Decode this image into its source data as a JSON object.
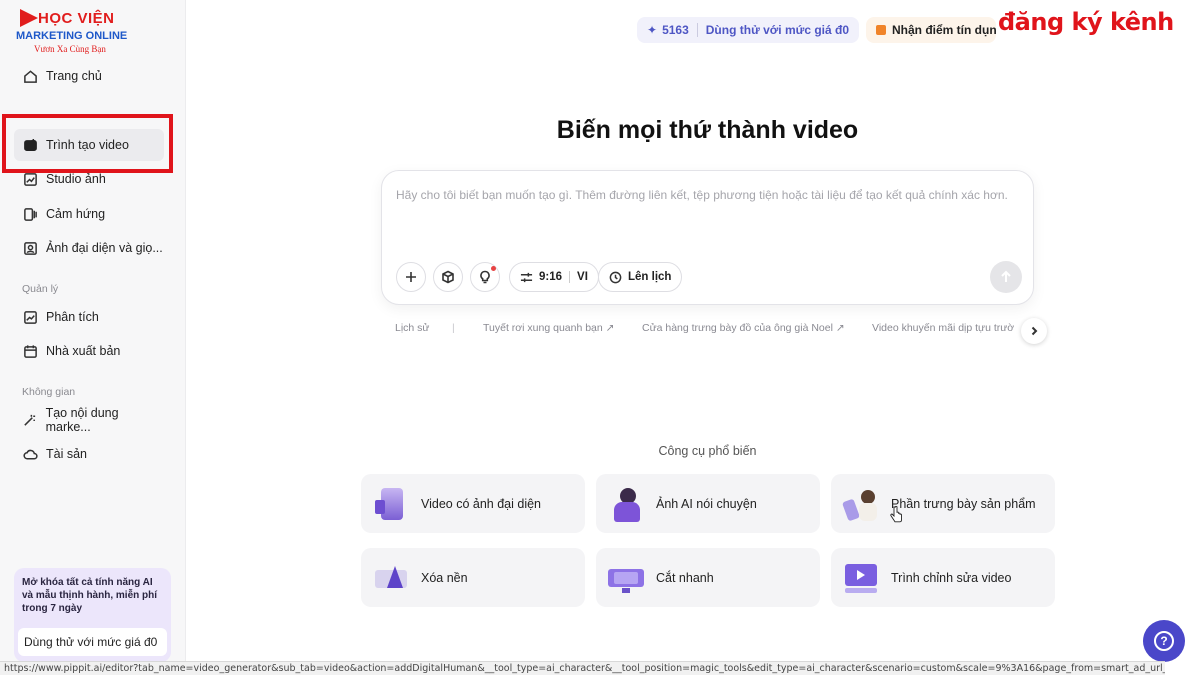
{
  "logo": {
    "brand_top": "HỌC VIỆN",
    "brand_mid": "MARKETING ONLINE",
    "brand_bot": "Vươn Xa Cùng Bạn"
  },
  "sidebar": {
    "home": "Trang chủ",
    "items": [
      {
        "label": "Trình tạo video",
        "icon": "video-plus-icon",
        "active": true
      },
      {
        "label": "Studio ảnh",
        "icon": "image-edit-icon"
      },
      {
        "label": "Cảm hứng",
        "icon": "inspiration-icon"
      },
      {
        "label": "Ảnh đại diện và giọ...",
        "icon": "avatar-icon"
      }
    ],
    "manage_label": "Quản lý",
    "manage_items": [
      {
        "label": "Phân tích",
        "icon": "analytics-icon"
      },
      {
        "label": "Nhà xuất bản",
        "icon": "calendar-icon"
      }
    ],
    "space_label": "Không gian",
    "space_items": [
      {
        "label": "Tạo nội dung marke...",
        "icon": "magic-wand-icon"
      },
      {
        "label": "Tài sản",
        "icon": "cloud-icon"
      }
    ],
    "promo_text": "Mở khóa tất cả tính năng AI và mẫu thịnh hành, miễn phí trong 7 ngày",
    "promo_button": "Dùng thử với mức giá đ0"
  },
  "topbar": {
    "credits": "5163",
    "trial_link": "Dùng thử với mức giá đ0",
    "reward": "Nhận điểm tín dụng",
    "watermark": "đăng ký kênh"
  },
  "hero": {
    "title": "Biến mọi thứ thành video",
    "placeholder": "Hãy cho tôi biết bạn muốn tạo gì. Thêm đường liên kết, tệp phương tiện hoặc tài liệu để tạo kết quả chính xác hơn.",
    "ratio": "9:16",
    "lang": "VI",
    "schedule": "Lên lịch"
  },
  "history": {
    "label": "Lịch sử",
    "items": [
      "Tuyết rơi xung quanh bạn ↗",
      "Cửa hàng trưng bày đồ của ông già Noel ↗",
      "Video khuyến mãi dịp tựu trườ"
    ]
  },
  "tools": {
    "title": "Công cụ phổ biến",
    "cards": [
      {
        "label": "Video có ảnh đại diện"
      },
      {
        "label": "Ảnh AI nói chuyện"
      },
      {
        "label": "Phần trưng bày sản phẩm"
      },
      {
        "label": "Xóa nền"
      },
      {
        "label": "Cắt nhanh"
      },
      {
        "label": "Trình chỉnh sửa video"
      }
    ]
  },
  "status_url": "https://www.pippit.ai/editor?tab_name=video_generator&sub_tab=video&action=addDigitalHuman&__tool_type=ai_character&__tool_position=magic_tools&edit_type=ai_character&scenario=custom&scale=9%3A16&page_from=smart_ad_url_analyze&enter...",
  "colors": {
    "accent": "#4a47c9",
    "highlight": "#e0141b",
    "credits_text": "#4e56c4"
  }
}
